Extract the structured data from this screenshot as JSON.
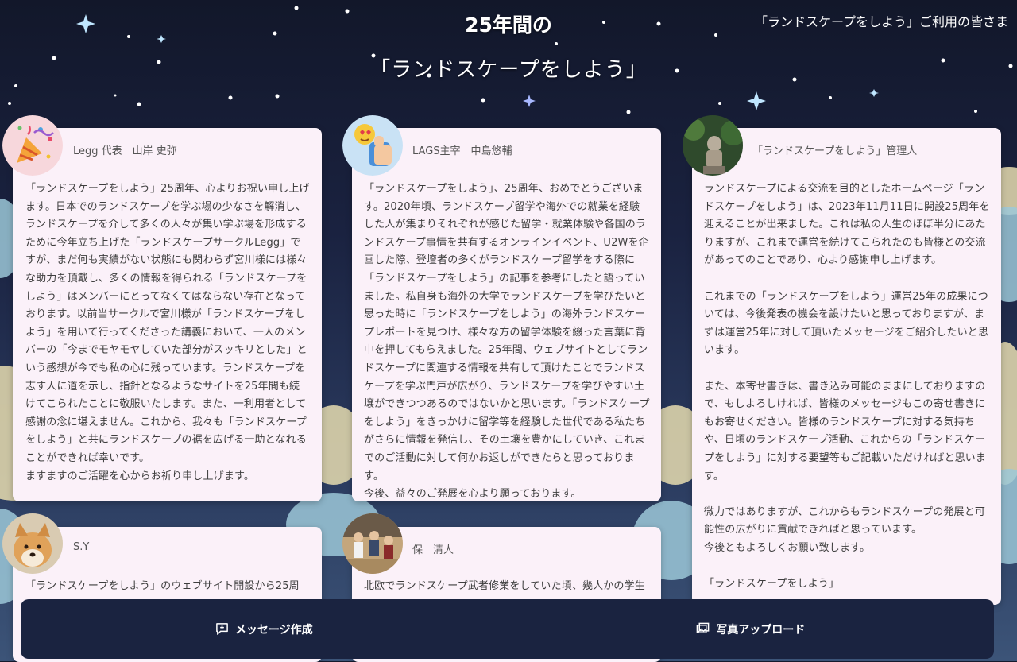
{
  "header": {
    "title_line1": "25年間の",
    "title_line2": "「ランドスケープをしよう」",
    "right_text": "「ランドスケープをしよう」ご利用の皆さま"
  },
  "cards": [
    {
      "author": "Legg 代表　山岸 史弥",
      "avatar_icon": "party-popper-icon",
      "body": "「ランドスケープをしよう」25周年、心よりお祝い申し上げます。日本でのランドスケープを学ぶ場の少なさを解消し、ランドスケープを介して多くの人々が集い学ぶ場を形成するために今年立ち上げた「ランドスケープサークルLegg」ですが、まだ何も実績がない状態にも関わらず宮川様には様々な助力を頂戴し、多くの情報を得られる「ランドスケープをしよう」はメンバーにとってなくてはならない存在となっております。以前当サークルで宮川様が「ランドスケープをしよう」を用いて行ってくださった講義において、一人のメンバーの「今までモヤモヤしていた部分がスッキリとした」という感想が今でも私の心に残っています。ランドスケープを志す人に道を示し、指針となるようなサイトを25年間も続けてこられたことに敬服いたします。また、一利用者として感謝の念に堪えません。これから、我々も「ランドスケープをしよう」と共にランドスケープの裾を広げる一助となれることができれば幸いです。\nますますのご活躍を心からお祈り申し上げます。"
    },
    {
      "author": "LAGS主宰　中島悠輔",
      "avatar_icon": "heart-eyes-thumbs-up-icon",
      "body": "「ランドスケープをしよう」、25周年、おめでとうございます。2020年頃、ランドスケープ留学や海外での就業を経験した人が集まりそれぞれが感じた留学・就業体験や各国のランドスケープ事情を共有するオンラインイベント、U2Wを企画した際、登壇者の多くがランドスケープ留学をする際に「ランドスケープをしよう」の記事を参考にしたと語っていました。私自身も海外の大学でランドスケープを学びたいと思った時に「ランドスケープをしよう」の海外ランドスケープレポートを見つけ、様々な方の留学体験を綴った言葉に背中を押してもらえました。25年間、ウェブサイトとしてランドスケープに関連する情報を共有して頂けたことでランドスケープを学ぶ門戸が広がり、ランドスケープを学びやすい土壌ができつつあるのではないかと思います。「ランドスケープをしよう」をきっかけに留学等を経験した世代である私たちがさらに情報を発信し、その土壌を豊かにしていき、これまでのご活動に対して何かお返しができたらと思っております。\n今後、益々のご発展を心より願っております。"
    },
    {
      "author": "「ランドスケープをしよう」管理人",
      "avatar_icon": "garden-statue-photo-icon",
      "body": "ランドスケープによる交流を目的としたホームページ「ランドスケープをしよう」は、2023年11月11日に開設25周年を迎えることが出来ました。これは私の人生のほぼ半分にあたりますが、これまで運営を続けてこられたのも皆様との交流があってのことであり、心より感謝申し上げます。\n\nこれまでの「ランドスケープをしよう」運営25年の成果については、今後発表の機会を設けたいと思っておりますが、まずは運営25年に対して頂いたメッセージをご紹介したいと思います。\n\nまた、本寄せ書きは、書き込み可能のままにしておりますので、もしよろしければ、皆様のメッセージもこの寄せ書きにもお寄せください。皆様のランドスケープに対する気持ちや、日頃のランドスケープ活動、これからの「ランドスケープをしよう」に対する要望等もご記載いただければと思います。\n\n微力ではありますが、これからもランドスケープの発展と可能性の広がりに貢献できればと思っています。\n今後ともよろしくお願い致します。\n\n「ランドスケープをしよう」"
    },
    {
      "author": "S.Y",
      "avatar_icon": "shiba-dog-photo-icon",
      "body": "「ランドスケープをしよう」のウェブサイト開設から25周"
    },
    {
      "author": "保　清人",
      "avatar_icon": "group-photo-icon",
      "body": "北欧でランドスケープ武者修業をしていた頃、幾人かの学生"
    }
  ],
  "actions": {
    "compose_label": "メッセージ作成",
    "compose_icon": "message-plus-icon",
    "upload_label": "写真アップロード",
    "upload_icon": "image-upload-icon"
  },
  "colors": {
    "sky": "#141a2e",
    "card_bg": "#fbf1f9",
    "action_bar": "#1a2340"
  }
}
